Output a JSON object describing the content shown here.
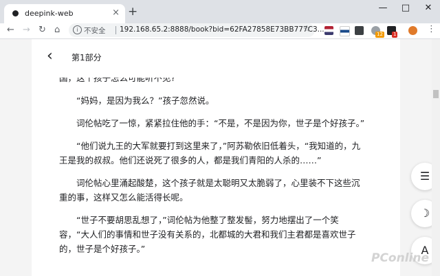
{
  "browser": {
    "tab_title": "deepink-web",
    "tab_close": "×",
    "new_tab": "+",
    "window": {
      "minimize": "—",
      "maximize": "□",
      "close": "✕"
    },
    "security_label": "不安全",
    "url": "192.168.65.2:8888/book?bid=62FA27858E73BB777C3...",
    "extension_badges": [
      "12",
      "1"
    ]
  },
  "reader": {
    "chapter_title": "第1部分",
    "paragraphs": [
      {
        "text": "国，这个孩子怎么可能听不见?",
        "indent": false
      },
      {
        "text": "“妈妈，是因为我么？”孩子忽然说。",
        "indent": true
      },
      {
        "text": "词伦帖吃了一惊，紧紧拉住他的手：“不是，不是因为你，世子是个好孩子。”",
        "indent": true
      },
      {
        "text": "“他们说九王的大军就要打到这里来了，”阿苏勒依旧低着头，“我知道的，九王是我的叔叔。他们还说死了很多的人，都是我们青阳的人杀的……”",
        "indent": true
      },
      {
        "text": "词伦帖心里涌起酸楚，这个孩子就是太聪明又太脆弱了，心里装不下这些沉重的事，这样又怎么能活得长呢。",
        "indent": true
      },
      {
        "text": "“世子不要胡思乱想了，”词伦帖为他整了整发髻，努力地摆出了一个笑容，“大人们的事情和世子没有关系的，北都城的大君和我们主君都是喜欢世子的，世子是个好孩子。”",
        "indent": true
      }
    ]
  },
  "floating_buttons": {
    "menu": "☰",
    "night": "☽",
    "font": "A"
  },
  "watermark": "PConline",
  "colors": {
    "tabstrip": "#dee1e6",
    "page_bg": "#f4f4f4",
    "text": "#202124"
  }
}
